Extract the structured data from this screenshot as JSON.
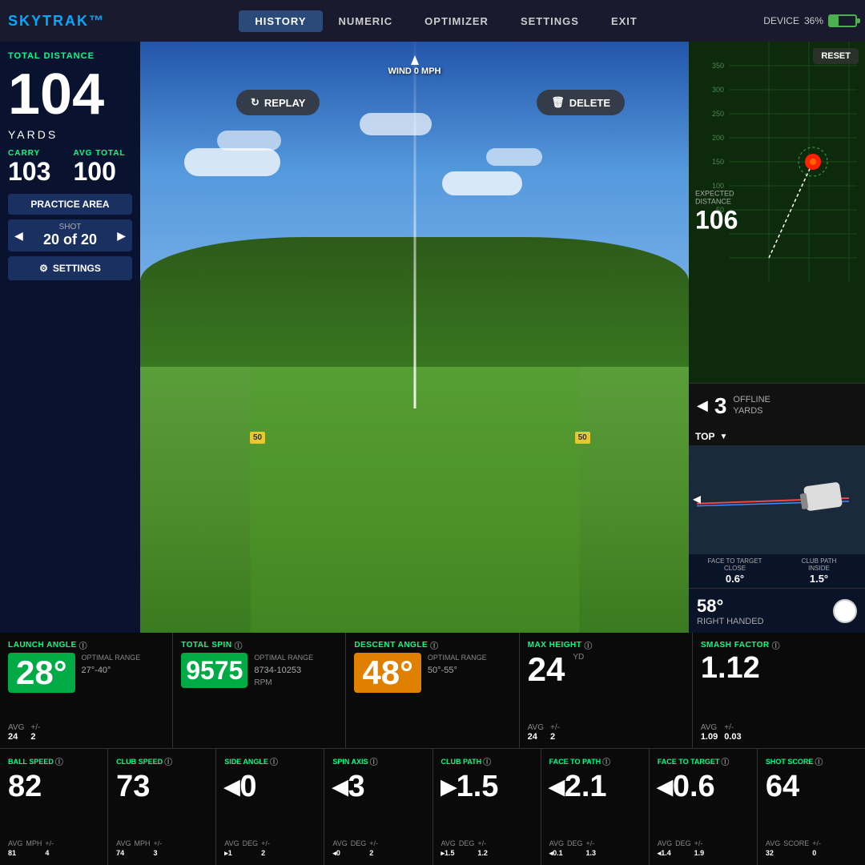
{
  "app": {
    "logo": "SKYTRAK"
  },
  "nav": {
    "items": [
      {
        "label": "HISTORY",
        "active": true
      },
      {
        "label": "NUMERIC",
        "active": false
      },
      {
        "label": "OPTIMIZER",
        "active": false
      },
      {
        "label": "SETTINGS",
        "active": false
      },
      {
        "label": "EXIT",
        "active": false
      }
    ],
    "device_label": "DEVICE",
    "battery_pct": "36%"
  },
  "wind": {
    "label": "WIND 0 MPH"
  },
  "scene_buttons": {
    "replay": "REPLAY",
    "delete": "DELETE"
  },
  "yard_markers": {
    "left": "50",
    "right": "50"
  },
  "left_panel": {
    "total_distance_label": "TOTAL DISTANCE",
    "total_distance_value": "104",
    "yards_label": "YARDS",
    "carry_label": "CARRY",
    "carry_value": "103",
    "avg_total_label": "AVG TOTAL",
    "avg_total_value": "100",
    "practice_area": "PRACTICE AREA",
    "shot_label": "SHOT",
    "shot_value": "20 of 20",
    "settings_label": "SETTINGS"
  },
  "right_panel": {
    "reset_btn": "RESET",
    "expected_distance_label": "EXPECTED\nDISTANCE",
    "expected_distance_value": "106",
    "offline_value": "3",
    "offline_label": "OFFLINE\nYARDS",
    "club_view_label": "TOP",
    "face_to_target_label": "FACE TO TARGET",
    "face_to_target_sub": "CLOSE",
    "face_to_target_value": "0.6°",
    "club_path_label": "CLUB PATH",
    "club_path_sub": "INSIDE",
    "club_path_value": "1.5°",
    "club_degree": "58°",
    "club_hand": "RIGHT HANDED"
  },
  "stats_row1": [
    {
      "title": "LAUNCH ANGLE",
      "value": "28°",
      "color": "green",
      "optimal_label": "OPTIMAL RANGE",
      "optimal_value": "27°-40°",
      "avg_label": "AVG",
      "avg_value": "24",
      "plusminus_label": "+/-",
      "plusminus_value": "2"
    },
    {
      "title": "TOTAL SPIN",
      "value": "9575",
      "color": "green",
      "optimal_label": "OPTIMAL RANGE",
      "optimal_value": "8734-10253",
      "unit": "RPM"
    },
    {
      "title": "DESCENT ANGLE",
      "value": "48°",
      "color": "orange",
      "optimal_label": "OPTIMAL RANGE",
      "optimal_value": "50°-55°"
    },
    {
      "title": "MAX HEIGHT",
      "value": "24",
      "unit": "YD",
      "avg_label": "AVG",
      "avg_value": "24",
      "plusminus_label": "+/-",
      "plusminus_value": "2"
    },
    {
      "title": "SMASH FACTOR",
      "value": "1.12",
      "avg_label": "AVG",
      "avg_value": "1.09",
      "plusminus_label": "+/-",
      "plusminus_value": "0.03"
    }
  ],
  "stats_row2": [
    {
      "title": "BALL SPEED",
      "value": "82",
      "unit": "MPH",
      "avg_value": "81",
      "plusminus_value": "4"
    },
    {
      "title": "CLUB SPEED",
      "value": "73",
      "unit": "MPH",
      "avg_value": "74",
      "plusminus_value": "3"
    },
    {
      "title": "SIDE ANGLE",
      "value": "◂0",
      "unit": "DEG",
      "avg_value": "▸1",
      "plusminus_value": "2"
    },
    {
      "title": "SPIN AXIS",
      "value": "◂3",
      "unit": "DEG",
      "avg_value": "◂0",
      "plusminus_value": "2"
    },
    {
      "title": "CLUB PATH",
      "value": "▸1.5",
      "unit": "DEG",
      "avg_value": "▸1.5",
      "plusminus_value": "1.2"
    },
    {
      "title": "FACE TO PATH",
      "value": "◂2.1",
      "unit": "DEG",
      "avg_value": "◂0.1",
      "plusminus_value": "1.3"
    },
    {
      "title": "FACE TO TARGET",
      "value": "◂0.6",
      "unit": "DEG",
      "avg_value": "◂1.4",
      "plusminus_value": "1.9"
    },
    {
      "title": "SHOT SCORE",
      "value": "64",
      "unit": "SCORE",
      "avg_value": "32",
      "plusminus_value": "0"
    }
  ]
}
